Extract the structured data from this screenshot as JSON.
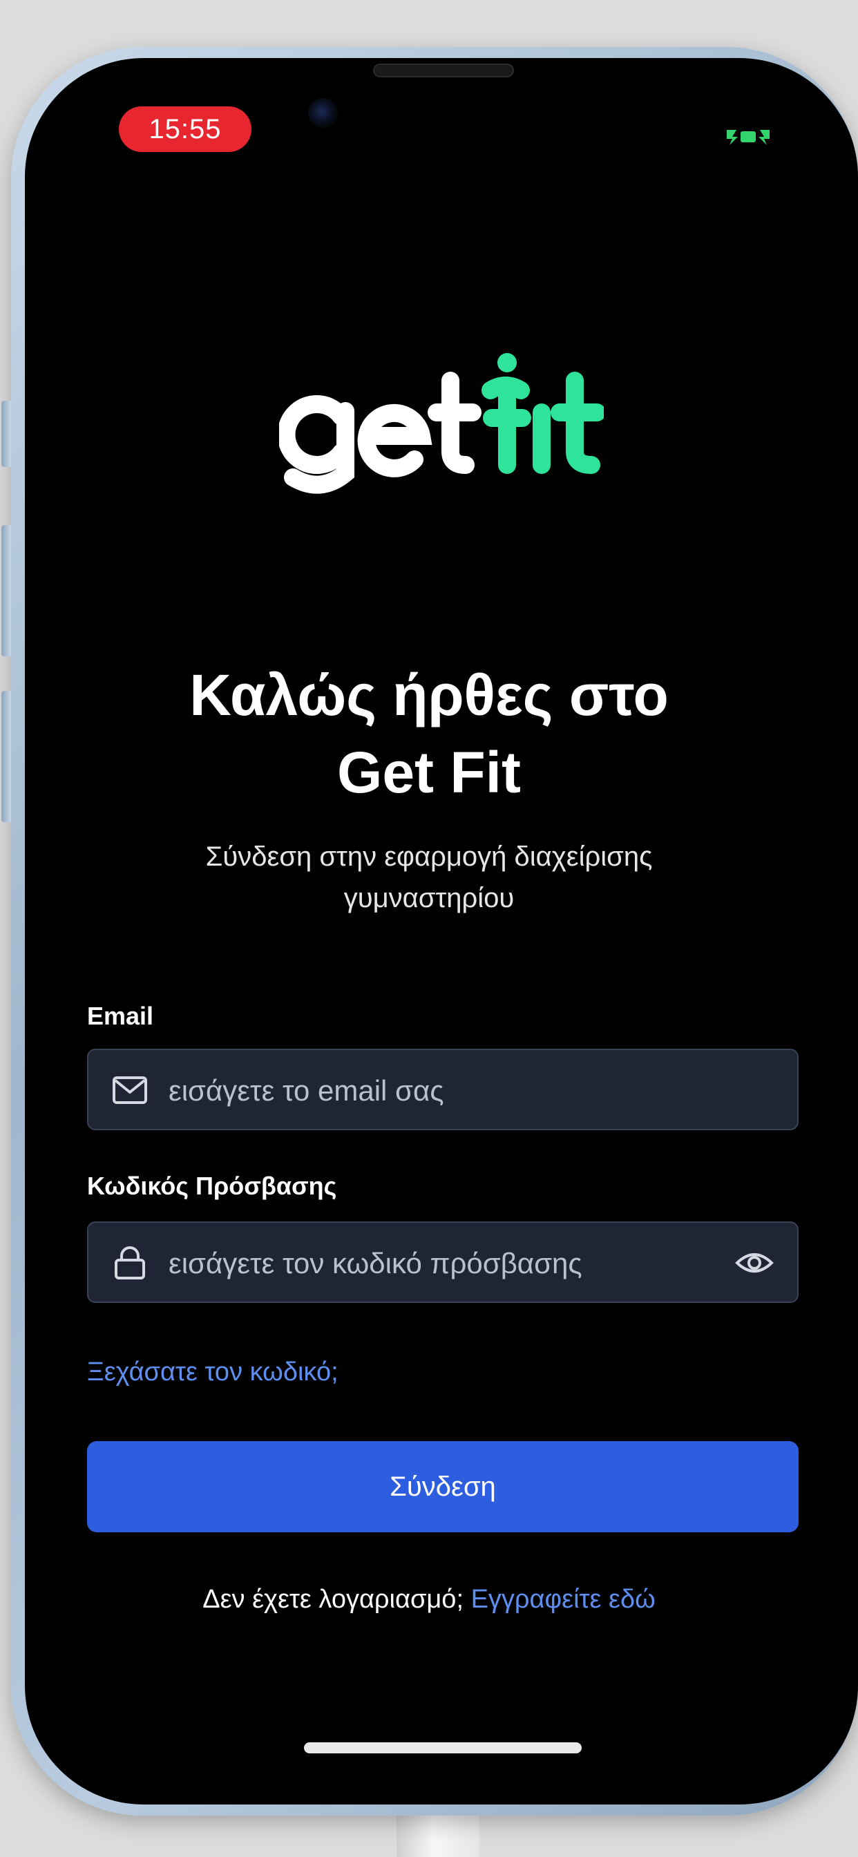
{
  "status_bar": {
    "time": "15:55",
    "battery_icon": "charging-battery-icon",
    "battery_color": "#33d46c"
  },
  "logo": {
    "word_left": "get",
    "word_right": "fit",
    "primary_color": "#ffffff",
    "accent_color": "#2fe39a"
  },
  "welcome": {
    "line1": "Καλώς ήρθες στο",
    "line2": "Get Fit"
  },
  "subtitle": {
    "line1": "Σύνδεση στην εφαρμογή διαχείρισης",
    "line2": "γυμναστηρίου"
  },
  "email": {
    "label": "Email",
    "placeholder": "εισάγετε το email σας",
    "icon": "mail-icon"
  },
  "password": {
    "label": "Κωδικός Πρόσβασης",
    "placeholder": "εισάγετε τον κωδικό πρόσβασης",
    "icon": "lock-icon",
    "toggle_icon": "eye-icon"
  },
  "forgot_password": "Ξεχάσατε τον κωδικό;",
  "login_button": "Σύνδεση",
  "signup": {
    "prompt": "Δεν έχετε λογαριασμό;",
    "link": "Εγγραφείτε εδώ"
  },
  "colors": {
    "background": "#000000",
    "field_bg": "#1f2535",
    "primary_button": "#2d5ee0",
    "link": "#5e8ff0",
    "time_pill": "#e8262f"
  }
}
